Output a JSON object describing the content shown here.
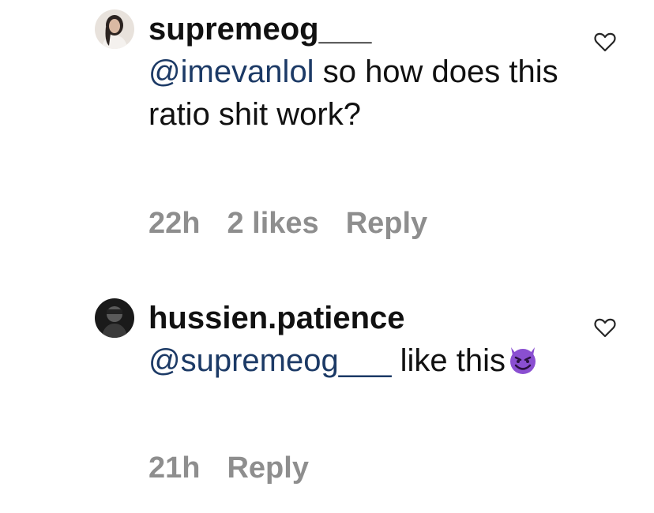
{
  "comments": [
    {
      "username": "supremeog___",
      "mention": "@imevanlol",
      "text": "so how does this ratio shit work?",
      "time": "22h",
      "likes": "2 likes",
      "reply": "Reply",
      "avatar_icon": "profile-photo-woman",
      "like_icon": "heart-outline-icon"
    },
    {
      "username": "hussien.patience",
      "mention": "@supremeog___",
      "text": "like this",
      "emoji": "smiling-devil-emoji",
      "time": "21h",
      "reply": "Reply",
      "avatar_icon": "profile-photo-dark",
      "like_icon": "heart-outline-icon"
    }
  ],
  "colors": {
    "text": "#111111",
    "mention": "#1c3a66",
    "meta": "#8e8e8e",
    "emoji": "#8a4fd1"
  }
}
